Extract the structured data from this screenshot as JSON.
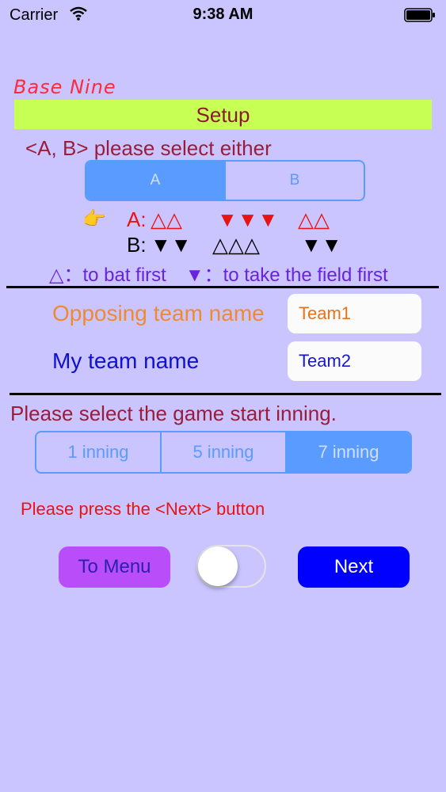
{
  "status_bar": {
    "carrier": "Carrier",
    "time": "9:38 AM"
  },
  "brand": "Base Nine",
  "title": "Setup",
  "ab_select": {
    "prompt": "<A, B> please select either",
    "options": [
      "A",
      "B"
    ],
    "selected": "A"
  },
  "order_table": {
    "row_a": {
      "label": "A:",
      "g1": "△△",
      "g2": "▼▼▼",
      "g3": "△△"
    },
    "row_b": {
      "label": "B:",
      "g1": "▼▼",
      "g2": "△△△",
      "g3": "▼▼"
    }
  },
  "legend": "△：to bat first　▼：to take the field first",
  "opposing_team": {
    "label": "Opposing team name",
    "value": "Team1"
  },
  "my_team": {
    "label": "My team name",
    "value": "Team2"
  },
  "inning_select": {
    "prompt": "Please select the game start inning.",
    "options": [
      "1 inning",
      "5 inning",
      "7 inning"
    ],
    "selected": "7 inning"
  },
  "instruction": "Please press the <Next> button",
  "buttons": {
    "menu": "To Menu",
    "next": "Next"
  },
  "toggle": {
    "on": false
  },
  "colors": {
    "background": "#cac5ff",
    "accent": "#5a9bff",
    "setup_bar": "#c7ff55",
    "next": "#0000ff",
    "menu": "#b94dfa"
  },
  "icons": [
    "wifi-icon",
    "battery-icon",
    "pointing-hand-icon"
  ]
}
